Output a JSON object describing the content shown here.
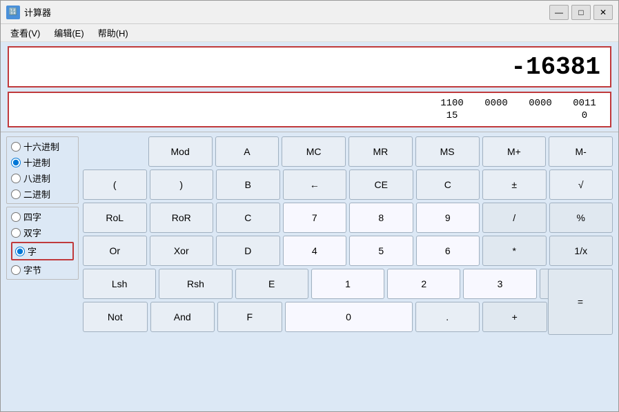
{
  "window": {
    "title": "计算器",
    "icon": "calc",
    "min_label": "—",
    "max_label": "□",
    "close_label": "✕"
  },
  "menu": {
    "items": [
      {
        "id": "view",
        "label": "查看(V)"
      },
      {
        "id": "edit",
        "label": "编辑(E)"
      },
      {
        "id": "help",
        "label": "帮助(H)"
      }
    ]
  },
  "display": {
    "main_value": "-16381",
    "binary_top": [
      "1100",
      "0000",
      "0000",
      "0011"
    ],
    "binary_bot": [
      "15",
      "",
      "",
      "0"
    ]
  },
  "radios": {
    "base_group": [
      {
        "id": "hex",
        "label": "十六进制",
        "checked": false
      },
      {
        "id": "dec",
        "label": "十进制",
        "checked": true
      },
      {
        "id": "oct",
        "label": "八进制",
        "checked": false
      },
      {
        "id": "bin",
        "label": "二进制",
        "checked": false
      }
    ],
    "word_group": [
      {
        "id": "qword",
        "label": "四字",
        "checked": false
      },
      {
        "id": "dword",
        "label": "双字",
        "checked": false
      },
      {
        "id": "word",
        "label": "字",
        "checked": true,
        "highlight": true
      },
      {
        "id": "byte",
        "label": "字节",
        "checked": false
      }
    ]
  },
  "buttons": {
    "row1": [
      {
        "id": "mod",
        "label": "Mod"
      },
      {
        "id": "a",
        "label": "A"
      },
      {
        "id": "mc",
        "label": "MC"
      },
      {
        "id": "mr",
        "label": "MR"
      },
      {
        "id": "ms",
        "label": "MS"
      },
      {
        "id": "mplus",
        "label": "M+"
      },
      {
        "id": "mminus",
        "label": "M-"
      }
    ],
    "row2": [
      {
        "id": "lparen",
        "label": "("
      },
      {
        "id": "rparen",
        "label": ")"
      },
      {
        "id": "b",
        "label": "B"
      },
      {
        "id": "backspace",
        "label": "←"
      },
      {
        "id": "ce",
        "label": "CE"
      },
      {
        "id": "c",
        "label": "C"
      },
      {
        "id": "pm",
        "label": "±"
      },
      {
        "id": "sqrt",
        "label": "√"
      }
    ],
    "row3": [
      {
        "id": "rol",
        "label": "RoL"
      },
      {
        "id": "ror",
        "label": "RoR"
      },
      {
        "id": "cc",
        "label": "C"
      },
      {
        "id": "n7",
        "label": "7"
      },
      {
        "id": "n8",
        "label": "8"
      },
      {
        "id": "n9",
        "label": "9"
      },
      {
        "id": "div",
        "label": "/"
      },
      {
        "id": "pct",
        "label": "%"
      }
    ],
    "row4": [
      {
        "id": "or",
        "label": "Or"
      },
      {
        "id": "xor",
        "label": "Xor"
      },
      {
        "id": "d",
        "label": "D"
      },
      {
        "id": "n4",
        "label": "4"
      },
      {
        "id": "n5",
        "label": "5"
      },
      {
        "id": "n6",
        "label": "6"
      },
      {
        "id": "mul",
        "label": "*"
      },
      {
        "id": "inv",
        "label": "1/x"
      }
    ],
    "row5": [
      {
        "id": "lsh",
        "label": "Lsh"
      },
      {
        "id": "rsh",
        "label": "Rsh"
      },
      {
        "id": "e",
        "label": "E"
      },
      {
        "id": "n1",
        "label": "1"
      },
      {
        "id": "n2",
        "label": "2"
      },
      {
        "id": "n3",
        "label": "3"
      },
      {
        "id": "sub",
        "label": "-"
      },
      {
        "id": "equals_tall",
        "label": "="
      }
    ],
    "row6": [
      {
        "id": "not",
        "label": "Not"
      },
      {
        "id": "and",
        "label": "And"
      },
      {
        "id": "f",
        "label": "F"
      },
      {
        "id": "n0",
        "label": "0"
      },
      {
        "id": "dot",
        "label": "."
      },
      {
        "id": "add",
        "label": "+"
      }
    ]
  },
  "colors": {
    "accent_red": "#c0393b",
    "bg_blue": "#dce8f5",
    "border_gray": "#a0b0c0"
  }
}
